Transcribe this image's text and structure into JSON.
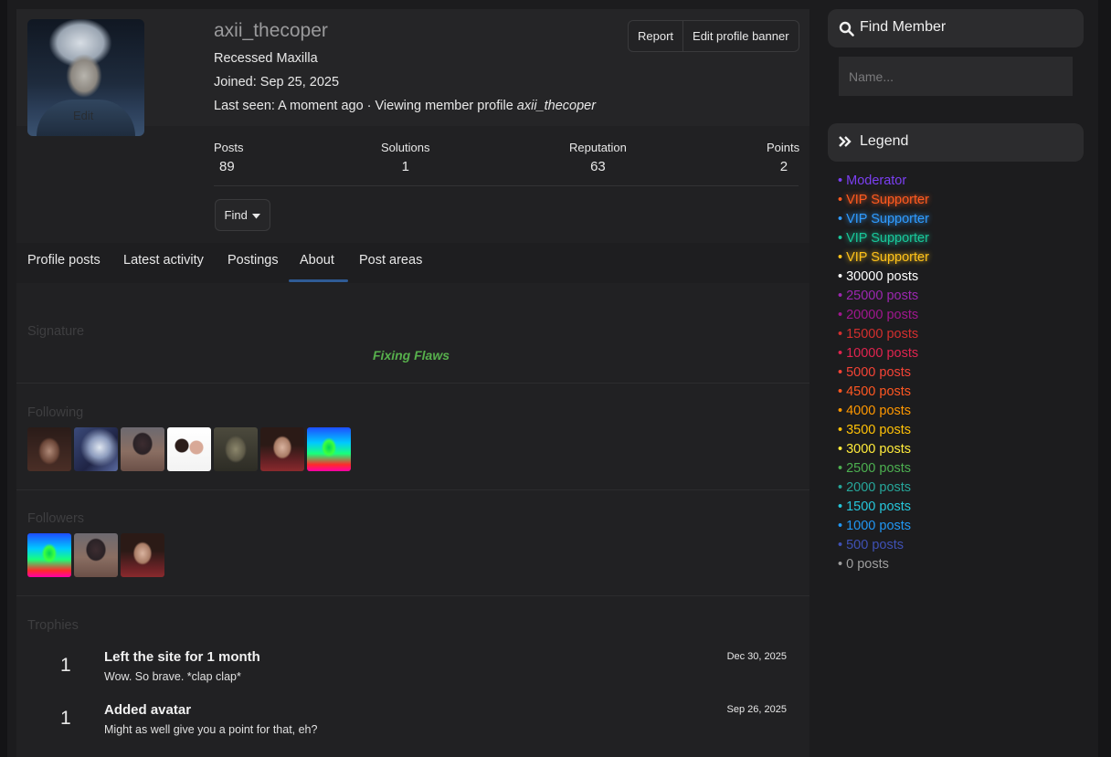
{
  "profile": {
    "username": "axii_thecoper",
    "avatar_edit_label": "Edit",
    "title": "Recessed Maxilla",
    "joined": "Joined: Sep 25, 2025",
    "last_seen_prefix": "Last seen: A moment ago · Viewing member profile ",
    "last_seen_target": "axii_thecoper",
    "buttons": {
      "report": "Report",
      "edit_banner": "Edit profile banner"
    },
    "stats": [
      {
        "label": "Posts",
        "value": "89"
      },
      {
        "label": "Solutions",
        "value": "1"
      },
      {
        "label": "Reputation",
        "value": "63"
      },
      {
        "label": "Points",
        "value": "2"
      }
    ],
    "find_label": "Find"
  },
  "tabs": [
    {
      "label": "Profile posts"
    },
    {
      "label": "Latest activity"
    },
    {
      "label": "Postings"
    },
    {
      "label": "About",
      "active": true
    },
    {
      "label": "Post areas"
    }
  ],
  "about": {
    "signature_label": "Signature",
    "signature_text": "Fixing Flaws",
    "following_label": "Following",
    "following_count_shown": 7,
    "followers_label": "Followers",
    "followers_count_shown": 3,
    "trophies_label": "Trophies",
    "trophies": [
      {
        "points": "1",
        "title": "Left the site for 1 month",
        "description": "Wow. So brave. *clap clap*",
        "date": "Dec 30, 2025"
      },
      {
        "points": "1",
        "title": "Added avatar",
        "description": "Might as well give you a point for that, eh?",
        "date": "Sep 26, 2025"
      }
    ]
  },
  "sidebar": {
    "find_member_title": "Find Member",
    "name_placeholder": "Name...",
    "legend_title": "Legend",
    "legend": [
      {
        "label": "Moderator",
        "color": "#7b3ff2"
      },
      {
        "label": "VIP Supporter",
        "color": "#ff5a1f"
      },
      {
        "label": "VIP Supporter",
        "color": "#2f9bff"
      },
      {
        "label": "VIP Supporter",
        "color": "#19c79a"
      },
      {
        "label": "VIP Supporter",
        "color": "#ffc21a"
      },
      {
        "label": "30000 posts",
        "color": "#ffffff"
      },
      {
        "label": "25000 posts",
        "color": "#9c27b0"
      },
      {
        "label": "20000 posts",
        "color": "#a0178f"
      },
      {
        "label": "15000 posts",
        "color": "#d32f2f"
      },
      {
        "label": "10000 posts",
        "color": "#e0244f"
      },
      {
        "label": "5000 posts",
        "color": "#f44336"
      },
      {
        "label": "4500 posts",
        "color": "#ff5722"
      },
      {
        "label": "4000 posts",
        "color": "#ff9800"
      },
      {
        "label": "3500 posts",
        "color": "#ffc107"
      },
      {
        "label": "3000 posts",
        "color": "#ffeb3b"
      },
      {
        "label": "2500 posts",
        "color": "#4caf50"
      },
      {
        "label": "2000 posts",
        "color": "#26a69a"
      },
      {
        "label": "1500 posts",
        "color": "#26c6da"
      },
      {
        "label": "1000 posts",
        "color": "#2196f3"
      },
      {
        "label": "500 posts",
        "color": "#3f51b5"
      },
      {
        "label": "0 posts",
        "color": "#9e9e9e"
      }
    ]
  }
}
